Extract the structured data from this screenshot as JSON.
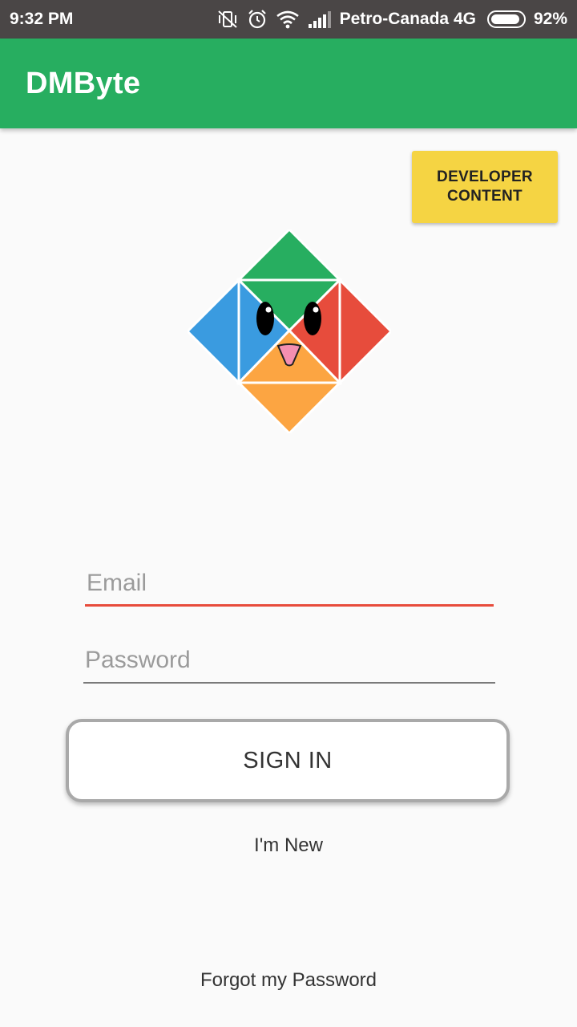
{
  "status_bar": {
    "time": "9:32 PM",
    "carrier": "Petro-Canada 4G",
    "battery_percent": "92%",
    "battery_level": 0.92,
    "icons": [
      "vibrate-off-icon",
      "alarm-icon",
      "wifi-icon",
      "signal-icon",
      "battery-icon"
    ]
  },
  "app_bar": {
    "title": "DMByte",
    "color": "#27ae60"
  },
  "developer_button": {
    "line1": "DEVELOPER",
    "line2": "CONTENT",
    "color": "#f5d443"
  },
  "logo": {
    "icon": "tangram-bird-logo",
    "colors": {
      "top": "#27ae60",
      "left": "#3a9be0",
      "right": "#e74c3c",
      "bottom": "#fca542",
      "beak": "#f48fb1"
    }
  },
  "form": {
    "email_placeholder": "Email",
    "email_value": "",
    "password_placeholder": "Password",
    "password_value": "",
    "email_underline_color": "#e74c3c"
  },
  "actions": {
    "sign_in": "SIGN IN",
    "new_user": "I'm New",
    "forgot_password": "Forgot my Password"
  }
}
